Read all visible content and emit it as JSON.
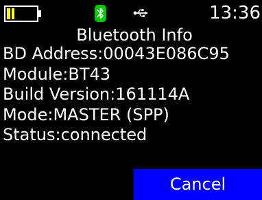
{
  "status_bar": {
    "battery_level": 0.25,
    "battery_color": "#ffff00",
    "bluetooth_icon": "bluetooth-icon",
    "bluetooth_color": "#00c800",
    "usb_icon": "usb-icon",
    "clock": "13:36"
  },
  "screen": {
    "title": "Bluetooth Info",
    "lines": [
      "BD Address:00043E086C95",
      "Module:BT43",
      "Build Version:161114A",
      "Mode:MASTER (SPP)",
      "Status:connected"
    ],
    "cancel_label": "Cancel",
    "accent_color": "#0000ff",
    "background_color": "#000000",
    "text_color": "#ffffff"
  }
}
